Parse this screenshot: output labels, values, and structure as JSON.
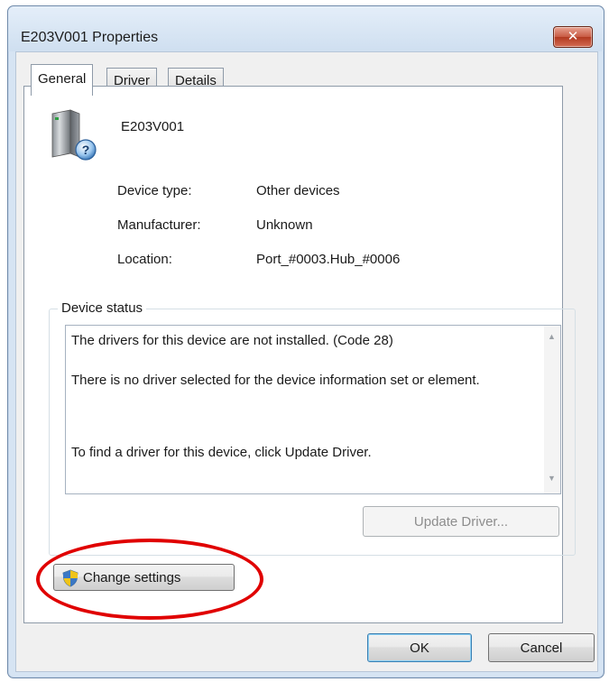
{
  "window": {
    "title": "E203V001 Properties",
    "close_label": "✕"
  },
  "tabs": [
    {
      "label": "General",
      "active": true
    },
    {
      "label": "Driver",
      "active": false
    },
    {
      "label": "Details",
      "active": false
    }
  ],
  "device": {
    "name": "E203V001",
    "icon": "unknown-device-icon"
  },
  "properties": [
    {
      "label": "Device type:",
      "value": "Other devices"
    },
    {
      "label": "Manufacturer:",
      "value": "Unknown"
    },
    {
      "label": "Location:",
      "value": "Port_#0003.Hub_#0006"
    }
  ],
  "device_status": {
    "legend": "Device status",
    "lines": [
      "The drivers for this device are not installed. (Code 28)",
      "There is no driver selected for the device information set or element.",
      "To find a driver for this device, click Update Driver."
    ]
  },
  "buttons": {
    "update_driver": "Update Driver...",
    "change_settings": "Change settings",
    "ok": "OK",
    "cancel": "Cancel"
  },
  "colors": {
    "annotation": "#e00000",
    "close_button": "#c75a43"
  }
}
